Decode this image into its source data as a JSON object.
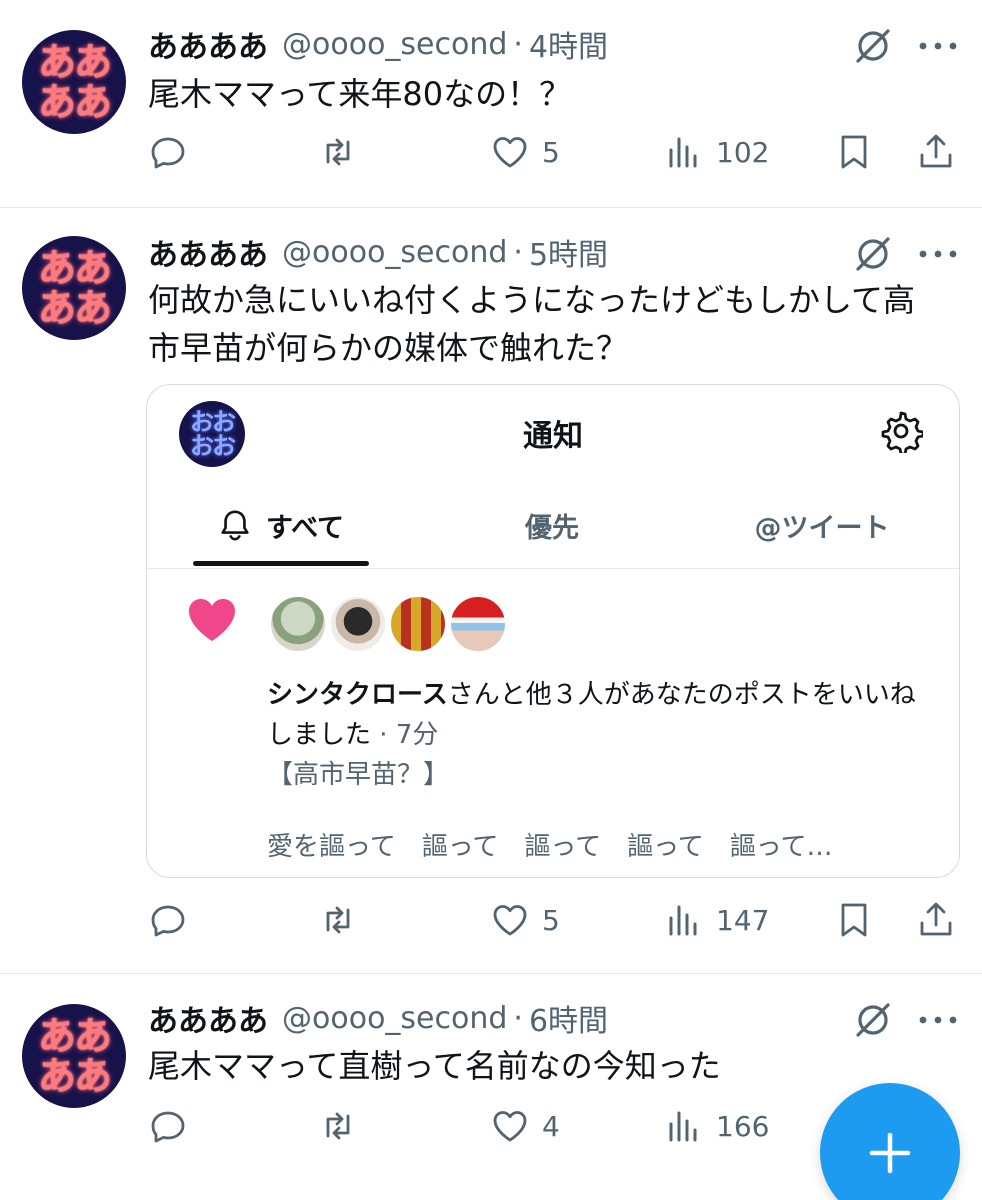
{
  "colors": {
    "text_primary": "#0f1419",
    "text_secondary": "#536471",
    "accent_blue": "#1d9bf0",
    "like_pink": "#f91880",
    "divider": "#e5e7eb"
  },
  "posts": [
    {
      "author_name": "ああああ",
      "avatar_lines": [
        "ああ",
        "ああ"
      ],
      "handle": "@oooo_second",
      "separator": "·",
      "time": "4時間",
      "text": "尾木ママって来年80なの！？",
      "replies": "",
      "reposts": "",
      "likes": "5",
      "views": "102"
    },
    {
      "author_name": "ああああ",
      "avatar_lines": [
        "ああ",
        "ああ"
      ],
      "handle": "@oooo_second",
      "separator": "·",
      "time": "5時間",
      "text": "何故か急にいいね付くようになったけどもしかして高市早苗が何らかの媒体で触れた？",
      "replies": "",
      "reposts": "",
      "likes": "5",
      "views": "147"
    },
    {
      "author_name": "ああああ",
      "avatar_lines": [
        "ああ",
        "ああ"
      ],
      "handle": "@oooo_second",
      "separator": "·",
      "time": "6時間",
      "text": "尾木ママって直樹って名前なの今知った",
      "replies": "",
      "reposts": "",
      "likes": "4",
      "views": "166"
    }
  ],
  "embedded_screenshot": {
    "avatar_lines": [
      "おお",
      "おお"
    ],
    "title": "通知",
    "tabs": [
      "すべて",
      "優先",
      "@ツイート"
    ],
    "active_tab": "すべて",
    "notification": {
      "actor": "シンタクロース",
      "message": "さんと他３人があなたのポストをいいねしました",
      "separator": "·",
      "time": "7分",
      "quoted": "【高市早苗？】",
      "preview": "愛を謳って　謳って　謳って　謳って　謳って…"
    }
  },
  "icons": {
    "reply": "reply-icon",
    "repost": "repost-icon",
    "like": "heart-icon",
    "views": "views-icon",
    "bookmark": "bookmark-icon",
    "share": "share-icon",
    "grok": "grok-icon",
    "more": "more-icon",
    "compose": "plus-icon"
  }
}
